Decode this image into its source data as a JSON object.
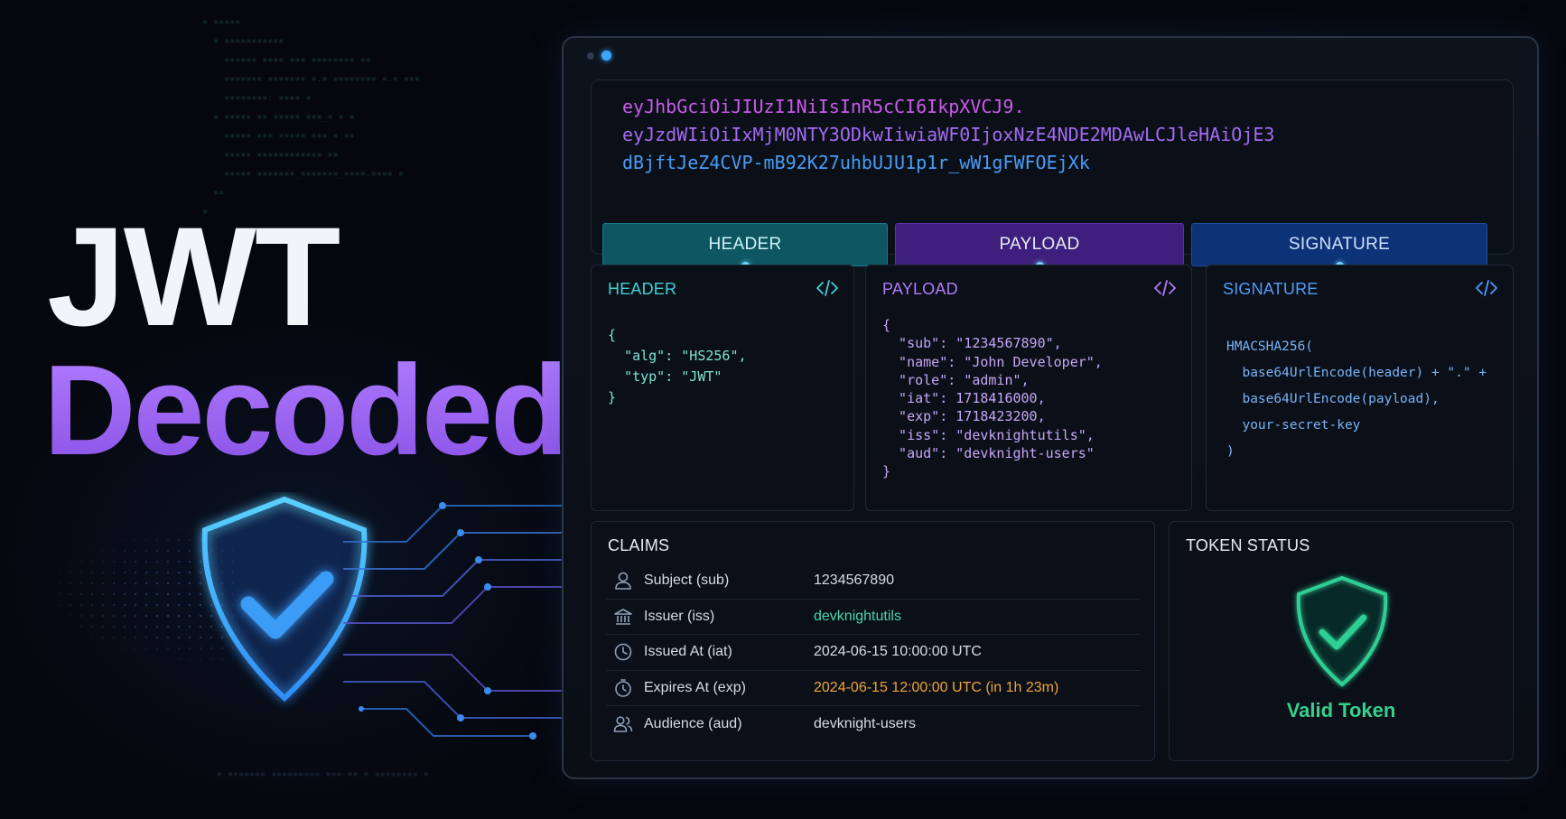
{
  "hero": {
    "line1": "JWT",
    "line2": "Decoded",
    "icon": "shield-check-icon"
  },
  "colors": {
    "accent_purple": "#9a66ee",
    "header_teal": "#3fd1d6",
    "signature_blue": "#4e9cf7",
    "valid_green": "#36d08e",
    "expiry_orange": "#f0a33a"
  },
  "token": {
    "header_part": "eyJhbGciOiJIUzI1NiIsInR5cCI6IkpXVCJ9.",
    "payload_part": "eyJzdWIiOiIxMjM0NTY3ODkwIiwiaWF0IjoxNzE4NDE2MDAwLCJleHAiOjE3",
    "signature_part": "dBjftJeZ4CVP-mB92K27uhbUJU1p1r_wW1gFWFOEjXk",
    "segments": {
      "header": "HEADER",
      "payload": "PAYLOAD",
      "signature": "SIGNATURE"
    }
  },
  "header_card": {
    "title": "HEADER",
    "icon": "code-icon",
    "code": "{\n  \"alg\": \"HS256\",\n  \"typ\": \"JWT\"\n}"
  },
  "payload_card": {
    "title": "PAYLOAD",
    "icon": "code-icon",
    "code": "{\n  \"sub\": \"1234567890\",\n  \"name\": \"John Developer\",\n  \"role\": \"admin\",\n  \"iat\": 1718416000,\n  \"exp\": 1718423200,\n  \"iss\": \"devknightutils\",\n  \"aud\": \"devknight-users\"\n}"
  },
  "signature_card": {
    "title": "SIGNATURE",
    "icon": "code-icon",
    "code": "HMACSHA256(\n  base64UrlEncode(header) + \".\" +\n  base64UrlEncode(payload),\n  your-secret-key\n)"
  },
  "claims": {
    "title": "CLAIMS",
    "rows": [
      {
        "icon": "user-icon",
        "label": "Subject (sub)",
        "value": "1234567890"
      },
      {
        "icon": "bank-icon",
        "label": "Issuer (iss)",
        "value": "devknightutils"
      },
      {
        "icon": "clock-icon",
        "label": "Issued At (iat)",
        "value": "2024-06-15 10:00:00 UTC"
      },
      {
        "icon": "stopwatch-icon",
        "label": "Expires At (exp)",
        "value": "2024-06-15 12:00:00 UTC (in 1h 23m)"
      },
      {
        "icon": "users-icon",
        "label": "Audience (aud)",
        "value": "devknight-users"
      }
    ]
  },
  "token_status": {
    "title": "TOKEN STATUS",
    "icon": "shield-check-icon",
    "status": "Valid Token"
  }
}
